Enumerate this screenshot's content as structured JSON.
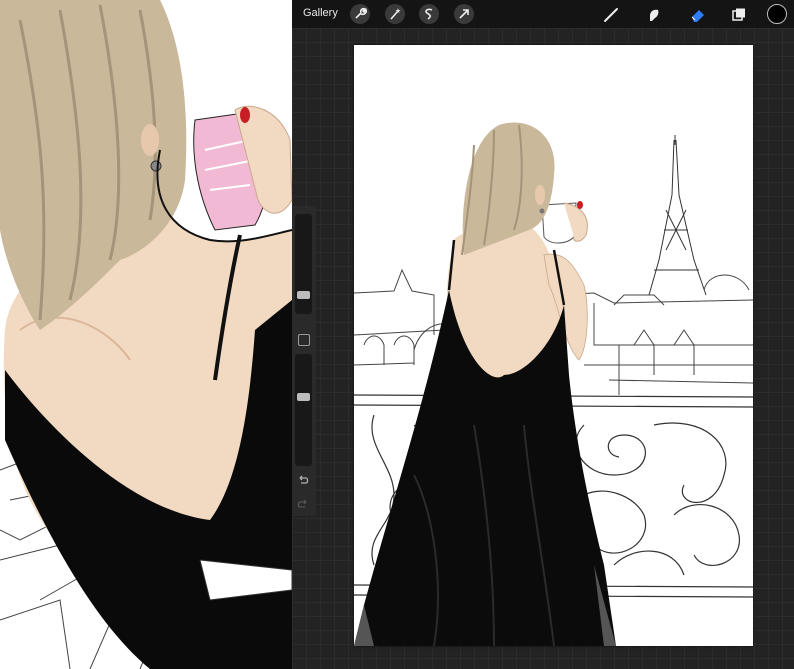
{
  "toolbar": {
    "gallery_label": "Gallery",
    "tools_left": [
      "actions-icon",
      "adjustments-icon",
      "selection-icon",
      "transform-icon"
    ],
    "tools_right": [
      "brush-icon",
      "smudge-icon",
      "eraser-icon",
      "layers-icon"
    ],
    "active_tool": "eraser-icon",
    "active_color": "#000000",
    "accent": "#2f7df6"
  },
  "sidebar": {
    "brush_size": 0.15,
    "opacity": 0.63
  }
}
